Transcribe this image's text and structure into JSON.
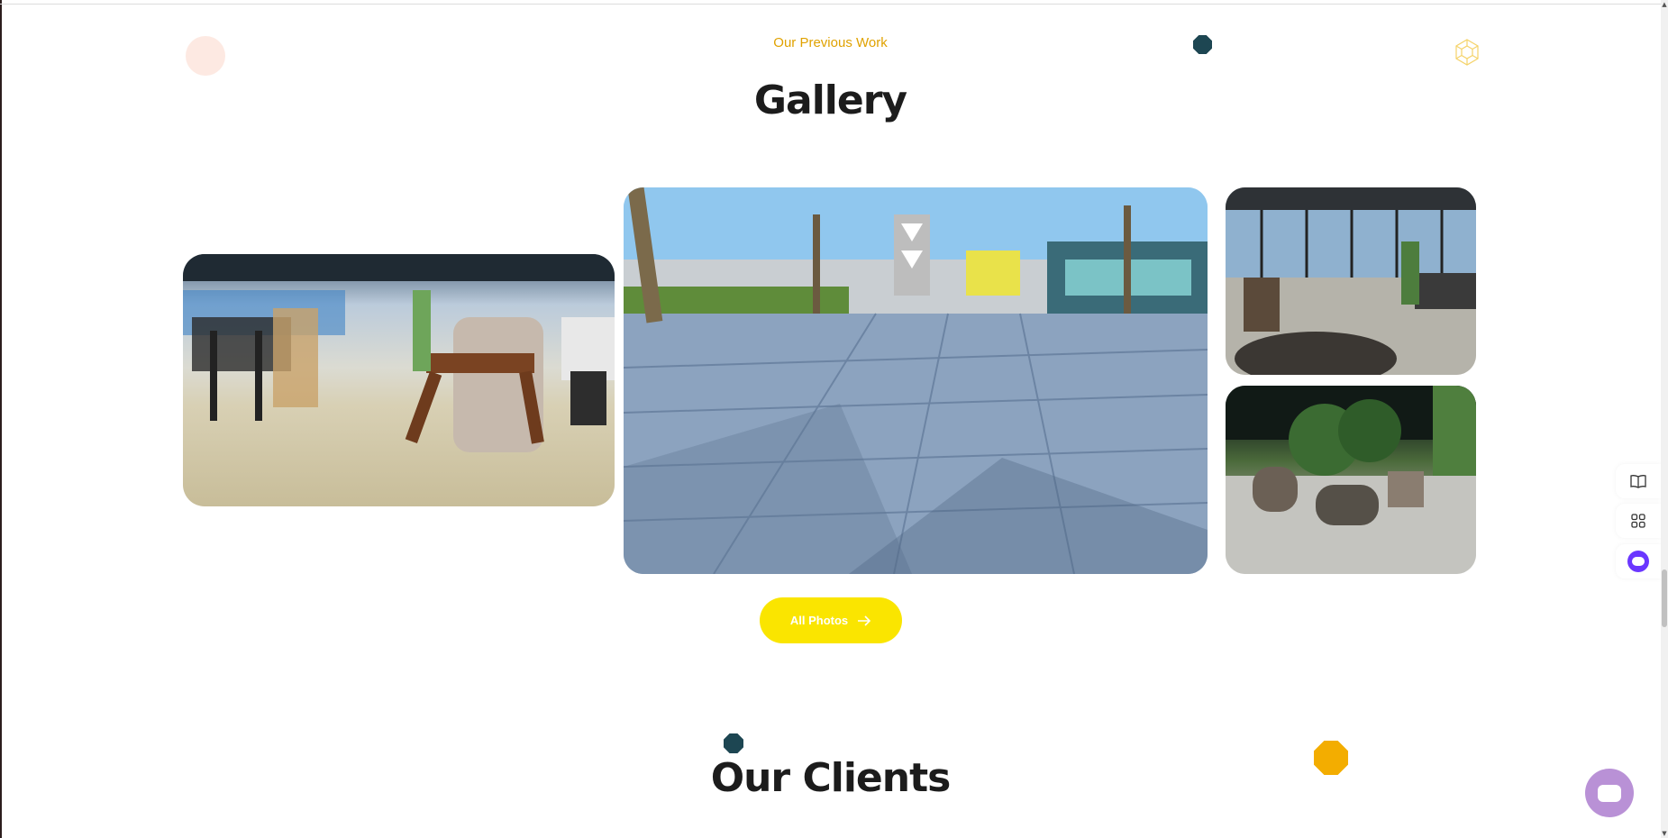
{
  "gallery": {
    "subtitle": "Our Previous Work",
    "title": "Gallery",
    "button_label": "All Photos",
    "button_icon": "arrow-right-icon"
  },
  "clients": {
    "title": "Our Clients"
  },
  "side_widgets": [
    {
      "icon": "book-icon"
    },
    {
      "icon": "grid-icon"
    },
    {
      "icon": "bot-icon"
    }
  ],
  "chat": {
    "icon": "chat-bubble-icon"
  },
  "colors": {
    "accent_yellow": "#fae500",
    "subtitle_orange": "#e0a200",
    "deco_dark": "#1d4652",
    "deco_orange": "#f3ad00",
    "chat_purple": "#b991d6"
  }
}
